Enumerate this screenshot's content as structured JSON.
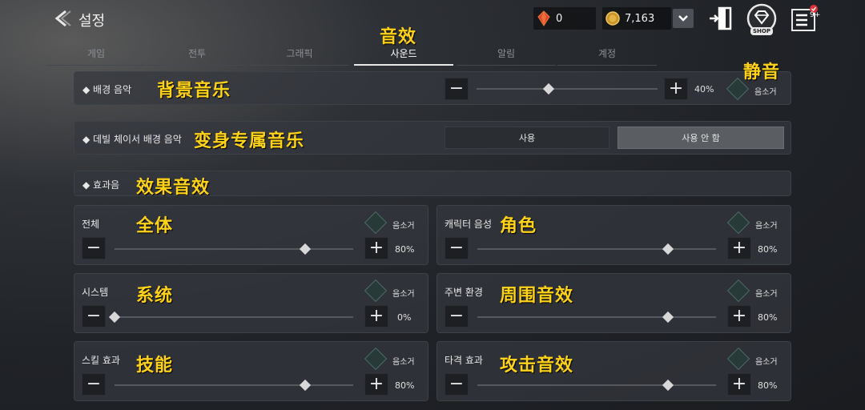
{
  "header": {
    "title": "설정",
    "ruby_count": "0",
    "gold_count": "7,163",
    "shop_label": "SHOP",
    "menu_badge": "9+"
  },
  "tabs": [
    {
      "label": "게임",
      "active": false
    },
    {
      "label": "전투",
      "active": false
    },
    {
      "label": "그래픽",
      "active": false
    },
    {
      "label": "사운드",
      "active": true
    },
    {
      "label": "알림",
      "active": false
    },
    {
      "label": "계정",
      "active": false
    }
  ],
  "bgm": {
    "label": "◆ 배경 음악",
    "percent": "40%",
    "value": 0.4,
    "mute_label": "음소거"
  },
  "devil": {
    "label": "◆ 데빌 체이서 배경 음악",
    "use_label": "사용",
    "not_use_label": "사용 안 함"
  },
  "sfx": {
    "label": "◆ 효과음"
  },
  "sliders": [
    {
      "key": "all",
      "label": "전체",
      "percent": "80%",
      "value": 0.8,
      "mute_label": "음소거"
    },
    {
      "key": "character",
      "label": "캐릭터 음성",
      "percent": "80%",
      "value": 0.8,
      "mute_label": "음소거"
    },
    {
      "key": "system",
      "label": "시스템",
      "percent": "0%",
      "value": 0.0,
      "mute_label": "음소거"
    },
    {
      "key": "ambient",
      "label": "주변 환경",
      "percent": "80%",
      "value": 0.8,
      "mute_label": "음소거"
    },
    {
      "key": "skill",
      "label": "스킬 효과",
      "percent": "80%",
      "value": 0.8,
      "mute_label": "음소거"
    },
    {
      "key": "hit",
      "label": "타격 효과",
      "percent": "80%",
      "value": 0.8,
      "mute_label": "음소거"
    }
  ],
  "annotations": {
    "sound": "音效",
    "mute": "静音",
    "bgm": "背景音乐",
    "devil": "变身专属音乐",
    "sfx": "效果音效",
    "all": "全体",
    "character": "角色",
    "system": "系统",
    "ambient": "周围音效",
    "skill": "技能",
    "hit": "攻击音效"
  },
  "colors": {
    "accent": "#ffd21a",
    "ruby": "#e0502a",
    "gold": "#d9a72a"
  }
}
